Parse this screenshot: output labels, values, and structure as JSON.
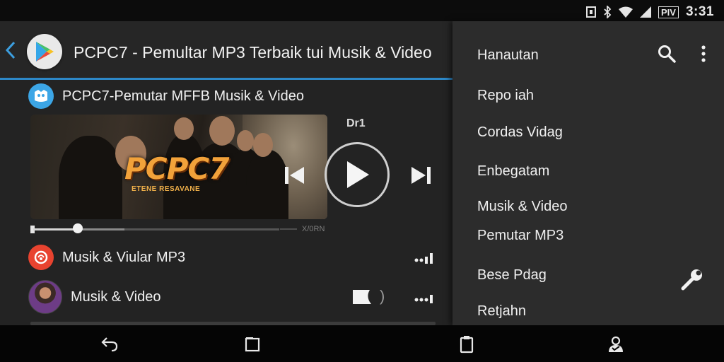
{
  "status_bar": {
    "time": "3:31",
    "battery_label": "PIV",
    "icons": [
      "data-icon",
      "bluetooth-icon",
      "wifi-icon",
      "signal-icon",
      "battery-icon"
    ]
  },
  "header": {
    "title": "PCPC7 - Pemultar MP3 Terbaik tui Musik & Video",
    "logo_icon": "play-store-icon"
  },
  "app_row": {
    "label": "PCPC7-Pemutar MFFB Musik & Video"
  },
  "player": {
    "thumbnail_title": "PCPC7",
    "thumbnail_subtitle": "ETENE RESAVANE",
    "mini_label": "Dr1",
    "time_label": "X/0RN",
    "progress": 0.18,
    "buffered": 0.37
  },
  "list": [
    {
      "label": "Musik & Viular MP3"
    },
    {
      "label": "Musik & Video"
    }
  ],
  "drawer": {
    "items": [
      "Hanautan",
      "Repo iah",
      "Cordas Vidag",
      "Enbegatam",
      "Musik & Video",
      "Pemutar MP3",
      "Bese Pdag",
      "Retjahn"
    ]
  },
  "colors": {
    "accent": "#2d88c8",
    "background": "#232323",
    "drawer": "#2c2c2c"
  }
}
